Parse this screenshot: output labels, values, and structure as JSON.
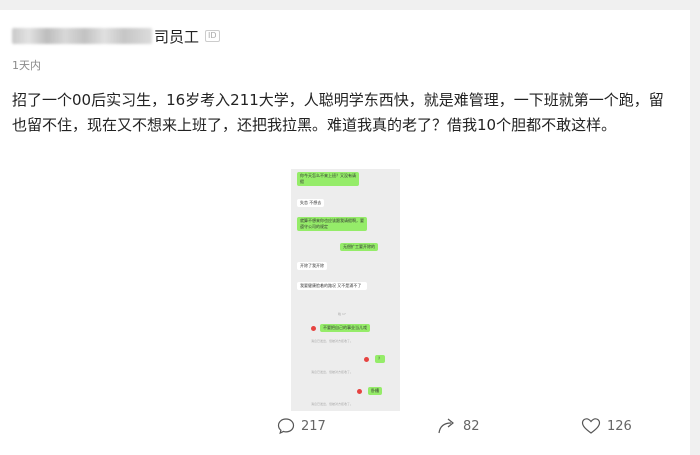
{
  "post": {
    "author_suffix": "司员工",
    "id_badge": "ID",
    "time": "1天内",
    "text": "招了一个00后实习生，16岁考入211大学，人聪明学东西快，就是难管理，一下班就第一个跑，留也留不住，现在又不想来上班了，还把我拉黑。难道我真的老了？借我10个胆都不敢这样。"
  },
  "chat": {
    "m1": "你今天怎么不来上班？又没有请假",
    "m2": "失恋 不想去",
    "m3": "就算不想来你也应该跟我请假啊，要遵守公司的规定",
    "m4": "无偿扩工要开除的",
    "m5": "开除了我开除",
    "m6": "我要健康脸着的路况 又不是涌不了",
    "sys1": "晚 17",
    "m7": "不要把自己的事业当儿戏",
    "sys2": "消息已发出，但被对方拒收了。",
    "m8": "？",
    "sys3": "消息已发出，但被对方拒收了。",
    "m9": "卧槽",
    "sys4": "消息已发出，但被对方拒收了。"
  },
  "actions": {
    "comments": "217",
    "reposts": "82",
    "likes": "126"
  }
}
